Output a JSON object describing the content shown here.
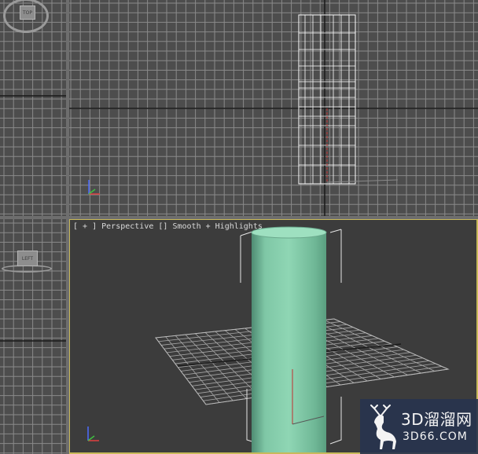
{
  "viewports": {
    "top": {
      "cube_label": "TOP"
    },
    "left": {
      "cube_label": "LEFT"
    },
    "perspective": {
      "label_plus": "[ + ]",
      "label_name": "Perspective",
      "label_shading": "[] Smooth + Highlights"
    }
  },
  "colors": {
    "viewport_bg": "#4d4d4d",
    "grid": "#8a8a8a",
    "grid_axis": "#1a1a1a",
    "active_border": "#c8b95a",
    "cylinder": "#7fc7a6",
    "wireframe": "#ffffff"
  },
  "watermark": {
    "line1": "3D溜溜网",
    "line2": "3D66.COM",
    "icon": "deer-logo-icon"
  }
}
